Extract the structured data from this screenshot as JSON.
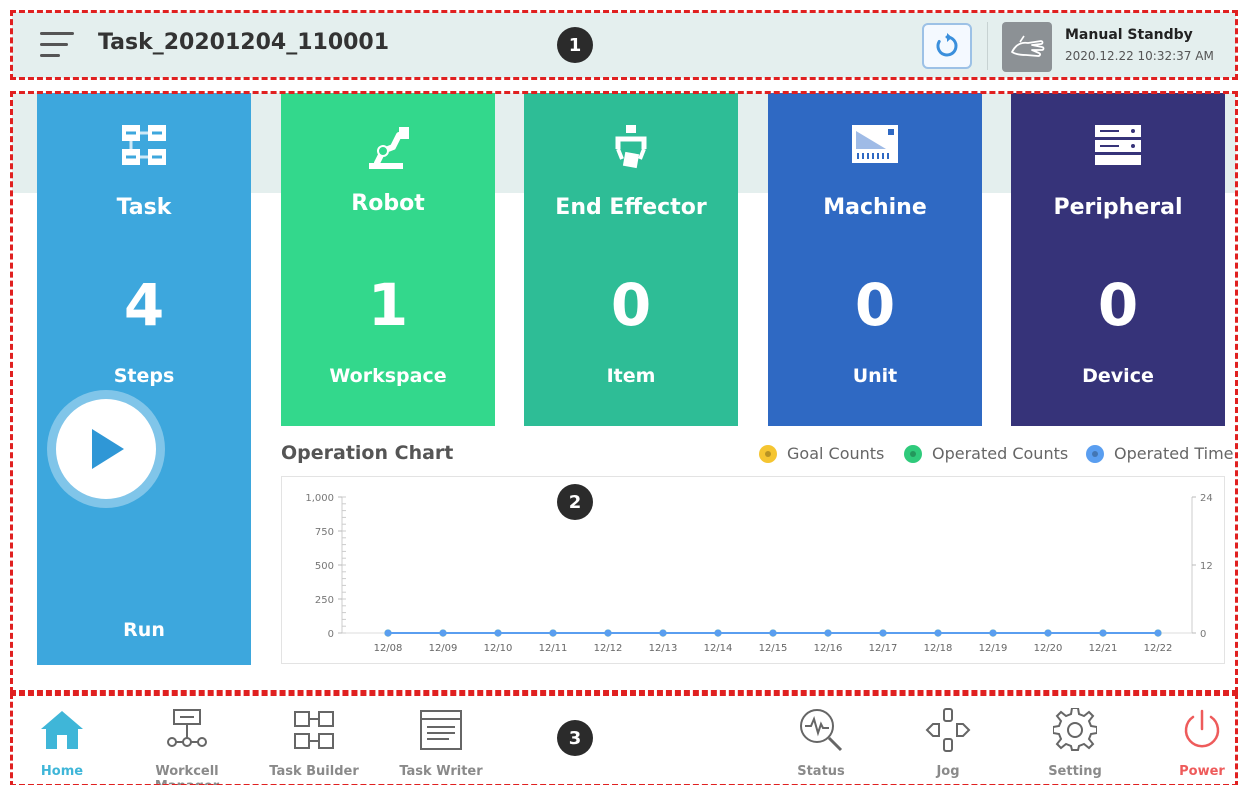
{
  "header": {
    "task_name": "Task_20201204_110001",
    "mode": "Manual Standby",
    "datetime": "2020.12.22 10:32:37 AM"
  },
  "markers": [
    "1",
    "2",
    "3"
  ],
  "tiles": [
    {
      "label": "Task",
      "count": "4",
      "unit": "Steps",
      "color": "#3da7dd",
      "icon": "task-flow-icon"
    },
    {
      "label": "Robot",
      "count": "1",
      "unit": "Workspace",
      "color": "#33d88c",
      "icon": "robot-arm-icon"
    },
    {
      "label": "End Effector",
      "count": "0",
      "unit": "Item",
      "color": "#2ebd96",
      "icon": "gripper-icon"
    },
    {
      "label": "Machine",
      "count": "0",
      "unit": "Unit",
      "color": "#2f69c3",
      "icon": "machine-icon"
    },
    {
      "label": "Peripheral",
      "count": "0",
      "unit": "Device",
      "color": "#363379",
      "icon": "peripheral-server-icon"
    }
  ],
  "run": {
    "label": "Run"
  },
  "chart": {
    "title": "Operation Chart",
    "legend": [
      {
        "label": "Goal Counts",
        "color": "#f5c531"
      },
      {
        "label": "Operated Counts",
        "color": "#2fca7b"
      },
      {
        "label": "Operated Time",
        "color": "#5a9ef0"
      }
    ]
  },
  "chart_data": {
    "type": "line",
    "title": "Operation Chart",
    "categories": [
      "12/08",
      "12/09",
      "12/10",
      "12/11",
      "12/12",
      "12/13",
      "12/14",
      "12/15",
      "12/16",
      "12/17",
      "12/18",
      "12/19",
      "12/20",
      "12/21",
      "12/22"
    ],
    "y_left_ticks": [
      "1,000",
      "750",
      "500",
      "250",
      "0"
    ],
    "y_right_ticks": [
      "24",
      "12",
      "0"
    ],
    "ylim_left": [
      0,
      1000
    ],
    "ylim_right": [
      0,
      24
    ],
    "series": [
      {
        "name": "Goal Counts",
        "values": [
          0,
          0,
          0,
          0,
          0,
          0,
          0,
          0,
          0,
          0,
          0,
          0,
          0,
          0,
          0
        ]
      },
      {
        "name": "Operated Counts",
        "values": [
          0,
          0,
          0,
          0,
          0,
          0,
          0,
          0,
          0,
          0,
          0,
          0,
          0,
          0,
          0
        ]
      },
      {
        "name": "Operated Time",
        "values": [
          0,
          0,
          0,
          0,
          0,
          0,
          0,
          0,
          0,
          0,
          0,
          0,
          0,
          0,
          0
        ]
      }
    ],
    "legend": "top-right",
    "grid": false
  },
  "nav": {
    "left": [
      {
        "label": "Home",
        "icon": "home-icon",
        "active": true
      },
      {
        "label": "Workcell Manager",
        "icon": "workcell-manager-icon"
      },
      {
        "label": "Task Builder",
        "icon": "task-builder-icon"
      },
      {
        "label": "Task Writer",
        "icon": "task-writer-icon"
      }
    ],
    "right": [
      {
        "label": "Status",
        "icon": "status-magnifier-icon"
      },
      {
        "label": "Jog",
        "icon": "jog-icon"
      },
      {
        "label": "Setting",
        "icon": "gear-icon"
      },
      {
        "label": "Power",
        "icon": "power-icon"
      }
    ],
    "active_color": "#3fb6d8",
    "power_color": "#ee5b5b"
  }
}
